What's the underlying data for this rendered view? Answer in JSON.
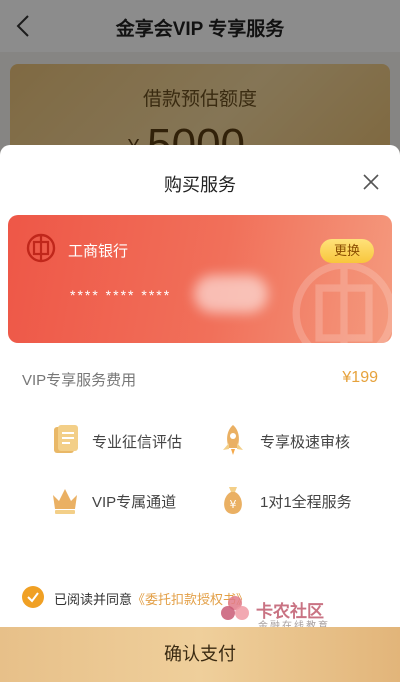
{
  "background": {
    "title": "金享会VIP 专享服务",
    "card_label": "借款预估额度",
    "currency_symbol": "¥",
    "amount_partial": "5000"
  },
  "sheet": {
    "title": "购买服务",
    "card": {
      "bank_name": "工商银行",
      "change_label": "更换",
      "number_masked": "**** **** ****"
    },
    "fee": {
      "label": "VIP专享服务费用",
      "price": "¥199"
    },
    "features": [
      {
        "label": "专业征信评估",
        "icon": "document-icon"
      },
      {
        "label": "专享极速审核",
        "icon": "rocket-icon"
      },
      {
        "label": "VIP专属通道",
        "icon": "crown-icon"
      },
      {
        "label": "1对1全程服务",
        "icon": "money-bag-icon"
      }
    ],
    "agreement": {
      "prefix": "已阅读并同意",
      "link": "《委托扣款授权书》",
      "checked": true
    },
    "confirm_label": "确认支付"
  },
  "watermark": {
    "title": "卡农社区",
    "subtitle": "金融在线教育"
  },
  "colors": {
    "accent": "#f0a024",
    "price": "#e6a23c",
    "card_red": "#ee5747",
    "confirm_gold": "#e7c089"
  }
}
